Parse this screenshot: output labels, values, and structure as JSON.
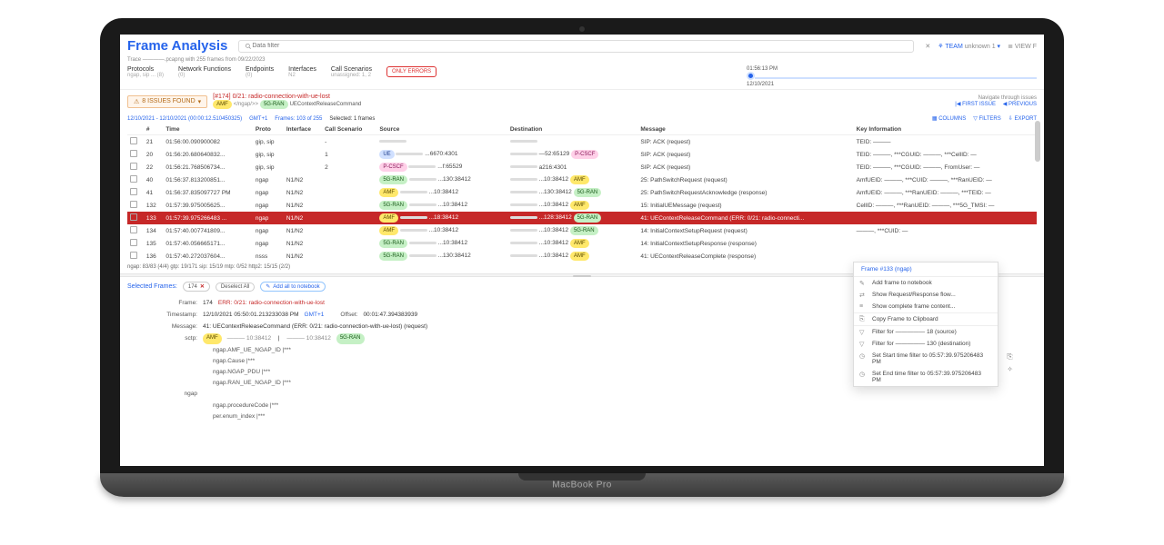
{
  "header": {
    "title": "Frame Analysis",
    "search_placeholder": "Data filter",
    "team_label": "TEAM",
    "team_user": "unknown 1",
    "view_btn": "VIEW F"
  },
  "subinfo": "Trace ————.pcapng with 255 frames from 09/22/2023",
  "nav": {
    "items": [
      {
        "label": "Protocols",
        "sub": "ngap, sip ... (8)"
      },
      {
        "label": "Network Functions",
        "sub": "(0)"
      },
      {
        "label": "Endpoints",
        "sub": "(0)"
      },
      {
        "label": "Interfaces",
        "sub": "N2"
      },
      {
        "label": "Call Scenarios",
        "sub": "unassigned: 1, 2"
      }
    ],
    "errors_btn": "ONLY ERRORS",
    "timeline_time": "01:56:13 PM",
    "timeline_date": "12/10/2021"
  },
  "issues": {
    "badge": "8 ISSUES FOUND",
    "frame_ref": "[#174] 0/21: radio-connection-with-ue-lost",
    "pills": [
      "AMF",
      "</ngap/>>",
      "5G-RAN"
    ],
    "msg": "UEContextReleaseCommand",
    "navi_label": "Navigate through issues",
    "first": "FIRST ISSUE",
    "prev": "PREVIOUS"
  },
  "filterbar": {
    "range": "12/10/2021 - 12/10/2021 (00:00:12.510450325)",
    "tz": "GMT+1",
    "frames": "Frames: 103 of 255",
    "selected": "Selected: 1 frames",
    "columns": "COLUMNS",
    "filters": "FILTERS",
    "export": "EXPORT"
  },
  "table": {
    "headers": [
      "",
      "#",
      "Time",
      "Proto",
      "Interface",
      "Call Scenario",
      "Source",
      "",
      "Destination",
      "",
      "Message",
      "Key Information"
    ],
    "rows": [
      {
        "n": "21",
        "t": "01:56:00.090900082",
        "p": "gip, sip",
        "if": "",
        "cs": "-",
        "src_tag": "",
        "src": "",
        "dst": "",
        "msg": "SIP: ACK (request)",
        "key": "TEID: ———"
      },
      {
        "n": "20",
        "t": "01:56:20.680640832...",
        "p": "gip, sip",
        "if": "",
        "cs": "1",
        "src_tag": "UE",
        "src": "...6670:4301",
        "dst": "—52:65129",
        "dst_tag": "P-CSCF",
        "msg": "SIP: ACK (request)",
        "key": "TEID: ———, ***CGUID: ———, ***CellID: —"
      },
      {
        "n": "22",
        "t": "01:56:21.768506734...",
        "p": "gip, sip",
        "if": "",
        "cs": "2",
        "src_tag": "P-CSCF",
        "src": "...f:65529",
        "dst": "a216:4301",
        "dst_tag": "",
        "msg": "SIP: ACK (request)",
        "key": "TEID: ———, ***CGUID: ———, FromUser: —"
      },
      {
        "n": "40",
        "t": "01:56:37.813200851...",
        "p": "ngap",
        "if": "N1/N2",
        "cs": "",
        "src_tag": "5G-RAN",
        "src": "...130:38412",
        "dst": "...10:38412",
        "dst_tag": "AMF",
        "msg": "25: PathSwitchRequest (request)",
        "key": "AmfUEID: ———, ***CUID: ———, ***RanUEID: —"
      },
      {
        "n": "41",
        "t": "01:56:37.835097727 PM",
        "p": "ngap",
        "if": "N1/N2",
        "cs": "",
        "src_tag": "AMF",
        "src": "...10:38412",
        "dst": "...130:38412",
        "dst_tag": "5G-RAN",
        "msg": "25: PathSwitchRequestAcknowledge (response)",
        "key": "AmfUEID: ———, ***RanUEID: ———, ***TEID: —"
      },
      {
        "n": "132",
        "t": "01:57:39.975005625...",
        "p": "ngap",
        "if": "N1/N2",
        "cs": "",
        "src_tag": "5G-RAN",
        "src": "...10:38412",
        "dst": "...10:38412",
        "dst_tag": "AMF",
        "msg": "15: InitialUEMessage (request)",
        "key": "CellID: ———, ***RanUEID: ———, ***5G_TMSI: —"
      },
      {
        "n": "133",
        "t": "01:57:39.975266483 ...",
        "p": "ngap",
        "if": "N1/N2",
        "cs": "",
        "src_tag": "AMF",
        "src": "...18:38412",
        "dst": "...128:38412",
        "dst_tag": "5G-RAN",
        "msg": "41: UEContextReleaseCommand (ERR: 0/21: radio-connecti...",
        "key": "",
        "sel": true
      },
      {
        "n": "134",
        "t": "01:57:40.007741809...",
        "p": "ngap",
        "if": "N1/N2",
        "cs": "",
        "src_tag": "AMF",
        "src": "...10:38412",
        "dst": "...10:38412",
        "dst_tag": "5G-RAN",
        "msg": "14: InitialContextSetupRequest (request)",
        "key": "———, ***CUID: —"
      },
      {
        "n": "135",
        "t": "01:57:40.056665171...",
        "p": "ngap",
        "if": "N1/N2",
        "cs": "",
        "src_tag": "5G-RAN",
        "src": "...10:38412",
        "dst": "...10:38412",
        "dst_tag": "AMF",
        "msg": "14: InitialContextSetupResponse (response)",
        "key": ""
      },
      {
        "n": "136",
        "t": "01:57:40.272037604...",
        "p": "nsss",
        "if": "N1/N2",
        "cs": "",
        "src_tag": "5G-RAN",
        "src": "...130:38412",
        "dst": "...10:38412",
        "dst_tag": "AMF",
        "msg": "41: UEContextReleaseComplete (response)",
        "key": ""
      }
    ]
  },
  "footer": "ngap: 83/83 (4/4)   gtp: 19/171   sip: 15/19   mtp: 0/52   http2: 15/15 (2/2)",
  "selected": {
    "label": "Selected Frames:",
    "count": "174",
    "deselect": "Deselect All",
    "addall": "Add all to notebook"
  },
  "detail": {
    "frame_lbl": "Frame:",
    "frame": "174",
    "frame_err": "ERR: 0/21: radio-connection-with-ue-lost",
    "ts_lbl": "Timestamp:",
    "ts": "12/10/2021 05:50:01.213233038 PM",
    "tz": "GMT+1",
    "offset_lbl": "Offset:",
    "offset": "00:01:47.394383939",
    "msg_lbl": "Message:",
    "msg": "41: UEContextReleaseCommand (ERR: 0/21: radio-connection-with-ue-lost) (request)",
    "sctp_lbl": "sctp:",
    "sctp_line": "[AMF] ——— 10:38412   |   ——— 10:38412 [5G-RAN]",
    "tree": [
      "ngap.AMF_UE_NGAP_ID   |***",
      "ngap.Cause   |***",
      "ngap.NGAP_PDU   |***",
      "ngap.RAN_UE_NGAP_ID   |***"
    ],
    "ngap_lbl": "ngap",
    "ngap_tree": [
      "ngap.procedureCode   |***",
      "per.enum_index   |***"
    ]
  },
  "ctxmenu": {
    "header": "Frame #133 (ngap)",
    "items": [
      {
        "icon": "✎",
        "label": "Add frame to notebook"
      },
      {
        "icon": "⇄",
        "label": "Show Request/Response flow..."
      },
      {
        "icon": "≡",
        "label": "Show complete frame content..."
      },
      {
        "icon": "⎘",
        "label": "Copy Frame to Clipboard",
        "sep": true
      },
      {
        "icon": "▽",
        "label": "Filter for ————— 18 (source)",
        "sep": true
      },
      {
        "icon": "▽",
        "label": "Filter for ————— 130 (destination)"
      },
      {
        "icon": "◷",
        "label": "Set Start time filter to 05:57:39.975206483 PM"
      },
      {
        "icon": "◷",
        "label": "Set End time filter to 05:57:39.975206483 PM"
      }
    ]
  },
  "chin": "MacBook Pro",
  "colors": {
    "accent": "#2563eb",
    "error": "#c62828"
  }
}
